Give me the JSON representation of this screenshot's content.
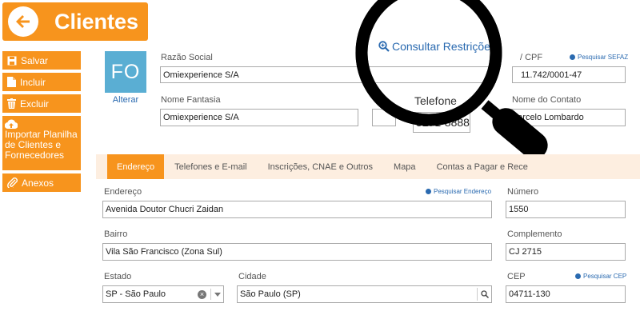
{
  "header": {
    "title": "Clientes"
  },
  "sidebar": {
    "salvar": "Salvar",
    "incluir": "Incluir",
    "excluir": "Excluir",
    "importar": "Importar Planilha de Clientes e Fornecedores",
    "anexos": "Anexos"
  },
  "profile": {
    "initials": "FO",
    "alterar": "Alterar"
  },
  "consultar": "Consultar Restrições",
  "fields": {
    "razao_label": "Razão Social",
    "razao_value": "Omiexperience S/A",
    "cnpj_label": "/ CPF",
    "cnpj_value": "11.742/0001-47",
    "sefaz_link": "Pesquisar SEFAZ",
    "fantasia_label": "Nome Fantasia",
    "fantasia_value": "Omiexperience S/A",
    "telefone_label": "Telefone",
    "telefone_value": "5171-8888",
    "contato_label": "Nome do Contato",
    "contato_value": "Marcelo Lombardo"
  },
  "tabs": [
    "Endereço",
    "Telefones e E-mail",
    "Inscrições, CNAE e Outros",
    "Mapa",
    "Contas a Pagar e Rece"
  ],
  "address": {
    "endereco_label": "Endereço",
    "endereco_link": "Pesquisar Endereço",
    "endereco_value": "Avenida Doutor Chucri Zaidan",
    "numero_label": "Número",
    "numero_value": "1550",
    "bairro_label": "Bairro",
    "bairro_value": "Vila São Francisco (Zona Sul)",
    "complemento_label": "Complemento",
    "complemento_value": "CJ 2715",
    "estado_label": "Estado",
    "estado_value": "SP - São Paulo",
    "cidade_label": "Cidade",
    "cidade_value": "São Paulo (SP)",
    "cep_label": "CEP",
    "cep_link": "Pesquisar CEP",
    "cep_value": "04711-130"
  },
  "colors": {
    "accent": "#f7941d",
    "link": "#2a6ab0",
    "logo_bg": "#5aaed3"
  }
}
